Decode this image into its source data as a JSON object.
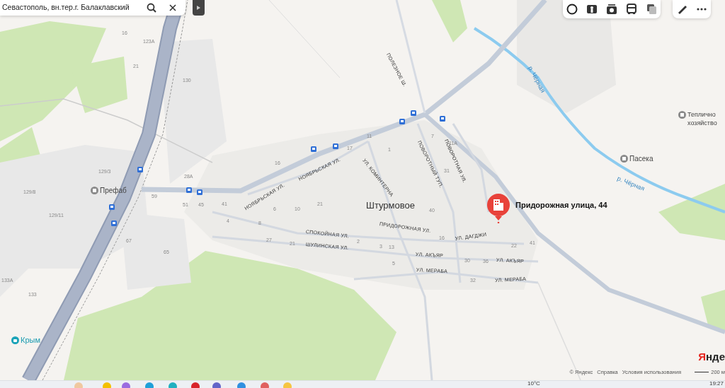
{
  "search": {
    "value": "Севастополь, вн.тер.г. Балаклавский"
  },
  "map": {
    "labels": [
      {
        "kind": "place",
        "text": "Штурмовое"
      },
      {
        "kind": "poi",
        "text": "Префаб"
      },
      {
        "kind": "poi",
        "text": "Пасека"
      },
      {
        "kind": "poi",
        "text": "Теплично хозяйство"
      },
      {
        "kind": "shop",
        "text": "Крым"
      },
      {
        "kind": "river",
        "text": "р. Чёрная"
      },
      {
        "kind": "river",
        "text": "р. Чёрная"
      },
      {
        "kind": "street",
        "text": "ПОЛЕЗНОЕ Ш."
      },
      {
        "kind": "street",
        "text": "НОЯБРЬСКАЯ УЛ."
      },
      {
        "kind": "street",
        "text": "НОЯБРЬСКАЯ УЛ."
      },
      {
        "kind": "street",
        "text": "УЛ. КОМИНТЕРНА"
      },
      {
        "kind": "street",
        "text": "ПОВОРОТНЫЙ ТУП."
      },
      {
        "kind": "street",
        "text": "ПОВОРОТНАЯ УЛ."
      },
      {
        "kind": "street",
        "text": "ПРИДОРОЖНАЯ УЛ."
      },
      {
        "kind": "street",
        "text": "СПОКОЙНАЯ УЛ."
      },
      {
        "kind": "street",
        "text": "ШУЛИНСКАЯ УЛ."
      },
      {
        "kind": "street",
        "text": "УЛ. ДАГДЖИ"
      },
      {
        "kind": "street",
        "text": "УЛ. АКЪЯР"
      },
      {
        "kind": "street",
        "text": "УЛ. АКЪЯР"
      },
      {
        "kind": "street",
        "text": "УЛ. МЕРАБА"
      },
      {
        "kind": "street",
        "text": "УЛ. МЕРАБА"
      },
      {
        "kind": "house",
        "text": "16"
      },
      {
        "kind": "house",
        "text": "123А"
      },
      {
        "kind": "house",
        "text": "21"
      },
      {
        "kind": "house",
        "text": "130"
      },
      {
        "kind": "house",
        "text": "129/3"
      },
      {
        "kind": "house",
        "text": "129/8"
      },
      {
        "kind": "house",
        "text": "129/11"
      },
      {
        "kind": "house",
        "text": "59"
      },
      {
        "kind": "house",
        "text": "28А"
      },
      {
        "kind": "house",
        "text": "51"
      },
      {
        "kind": "house",
        "text": "45"
      },
      {
        "kind": "house",
        "text": "41"
      },
      {
        "kind": "house",
        "text": "67"
      },
      {
        "kind": "house",
        "text": "65"
      },
      {
        "kind": "house",
        "text": "133А"
      },
      {
        "kind": "house",
        "text": "133"
      },
      {
        "kind": "house",
        "text": "16"
      },
      {
        "kind": "house",
        "text": "6"
      },
      {
        "kind": "house",
        "text": "10"
      },
      {
        "kind": "house",
        "text": "4"
      },
      {
        "kind": "house",
        "text": "8"
      },
      {
        "kind": "house",
        "text": "27"
      },
      {
        "kind": "house",
        "text": "21"
      },
      {
        "kind": "house",
        "text": "21"
      },
      {
        "kind": "house",
        "text": "2"
      },
      {
        "kind": "house",
        "text": "3"
      },
      {
        "kind": "house",
        "text": "13"
      },
      {
        "kind": "house",
        "text": "5"
      },
      {
        "kind": "house",
        "text": "11"
      },
      {
        "kind": "house",
        "text": "17"
      },
      {
        "kind": "house",
        "text": "1"
      },
      {
        "kind": "house",
        "text": "7"
      },
      {
        "kind": "house",
        "text": "11А"
      },
      {
        "kind": "house",
        "text": "31"
      },
      {
        "kind": "house",
        "text": "40"
      },
      {
        "kind": "house",
        "text": "16"
      },
      {
        "kind": "house",
        "text": "30"
      },
      {
        "kind": "house",
        "text": "36"
      },
      {
        "kind": "house",
        "text": "22"
      },
      {
        "kind": "house",
        "text": "41"
      },
      {
        "kind": "house",
        "text": "32"
      }
    ],
    "pin": {
      "label": "Придорожная улица, 44"
    }
  },
  "attribution": {
    "logo": "Янде",
    "copyright": "© Яндекс",
    "links": [
      "Справка",
      "Условия использования"
    ],
    "scale": "200 м"
  },
  "taskbar": {
    "weather": "10°C",
    "time": "19:27"
  }
}
